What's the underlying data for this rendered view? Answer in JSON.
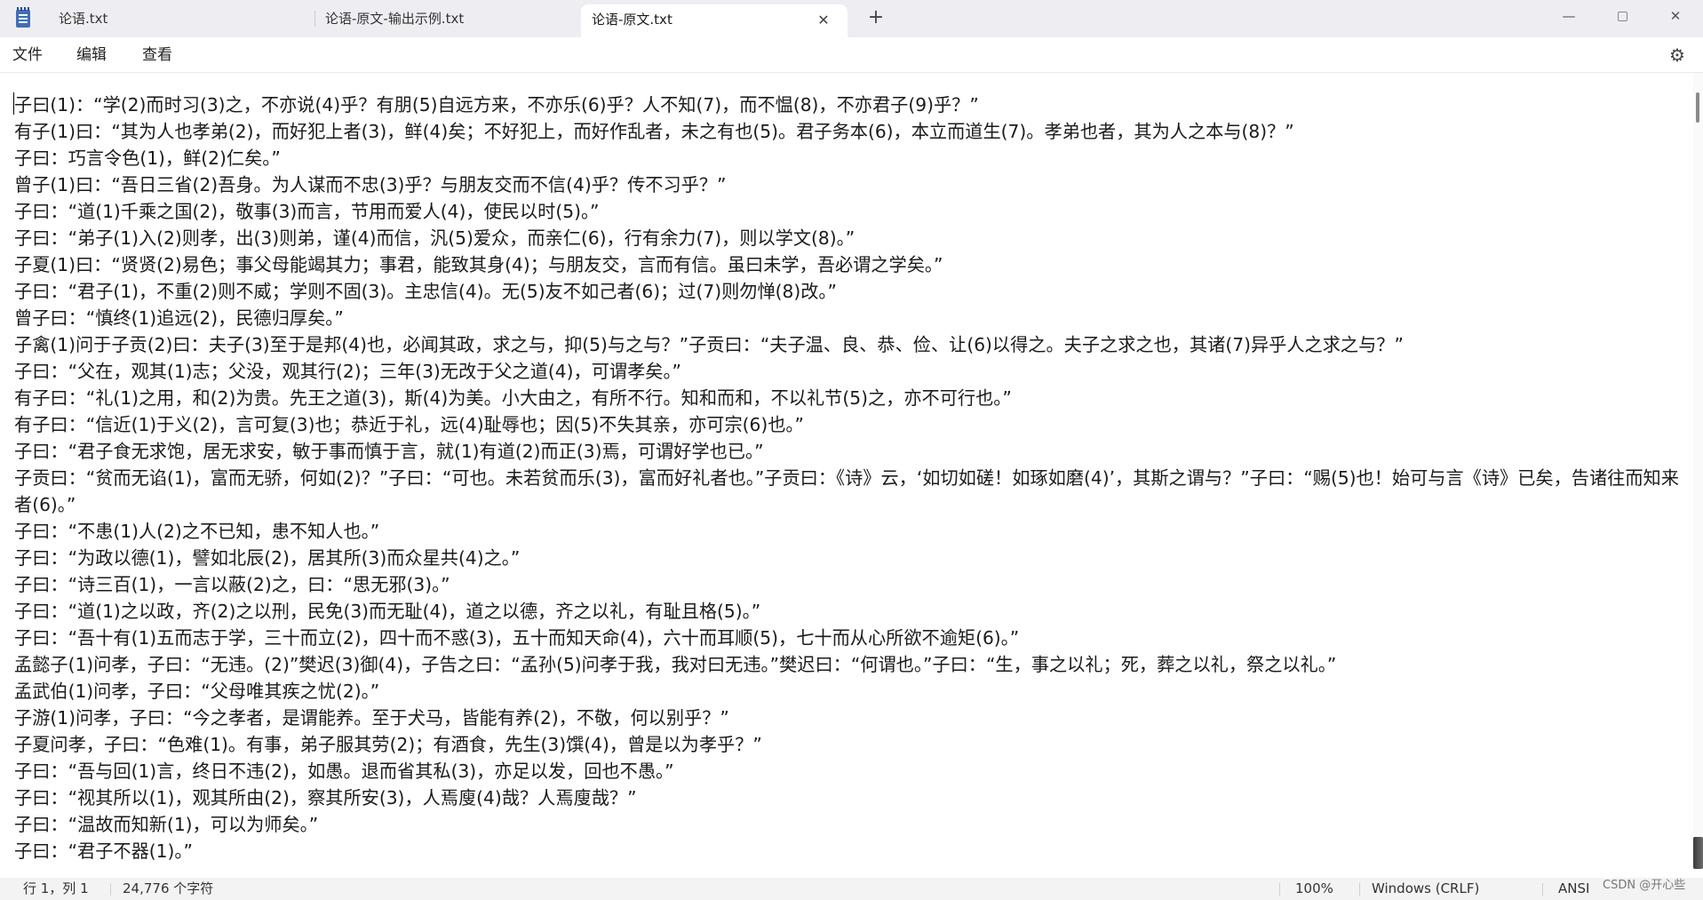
{
  "tabs": [
    {
      "label": "论语.txt"
    },
    {
      "label": "论语-原文-输出示例.txt"
    },
    {
      "label": "论语-原文.txt",
      "active": true
    }
  ],
  "icons": {
    "app": "notepad-icon",
    "close": "close-icon",
    "new_tab": "plus-icon",
    "settings": "gear-icon"
  },
  "menu": {
    "file": "文件",
    "edit": "编辑",
    "view": "查看"
  },
  "editor_text": "子曰(1)：“学(2)而时习(3)之，不亦说(4)乎？有朋(5)自远方来，不亦乐(6)乎？人不知(7)，而不愠(8)，不亦君子(9)乎？”\n有子(1)曰：“其为人也孝弟(2)，而好犯上者(3)，鲜(4)矣；不好犯上，而好作乱者，未之有也(5)。君子务本(6)，本立而道生(7)。孝弟也者，其为人之本与(8)？”\n子曰：巧言令色(1)，鲜(2)仁矣。”\n曾子(1)曰：“吾日三省(2)吾身。为人谋而不忠(3)乎？与朋友交而不信(4)乎？传不习乎？”\n子曰：“道(1)千乘之国(2)，敬事(3)而言，节用而爱人(4)，使民以时(5)。”\n子曰：“弟子(1)入(2)则孝，出(3)则弟，谨(4)而信，汎(5)爱众，而亲仁(6)，行有余力(7)，则以学文(8)。”\n子夏(1)曰：“贤贤(2)易色；事父母能竭其力；事君，能致其身(4)；与朋友交，言而有信。虽曰未学，吾必谓之学矣。”\n子曰：“君子(1)，不重(2)则不威；学则不固(3)。主忠信(4)。无(5)友不如己者(6)；过(7)则勿惮(8)改。”\n曾子曰：“慎终(1)追远(2)，民德归厚矣。”\n子禽(1)问于子贡(2)曰：夫子(3)至于是邦(4)也，必闻其政，求之与，抑(5)与之与？”子贡曰：“夫子温、良、恭、俭、让(6)以得之。夫子之求之也，其诸(7)异乎人之求之与？”\n子曰：“父在，观其(1)志；父没，观其行(2)；三年(3)无改于父之道(4)，可谓孝矣。”\n有子曰：“礼(1)之用，和(2)为贵。先王之道(3)，斯(4)为美。小大由之，有所不行。知和而和，不以礼节(5)之，亦不可行也。”\n有子曰：“信近(1)于义(2)，言可复(3)也；恭近于礼，远(4)耻辱也；因(5)不失其亲，亦可宗(6)也。”\n子曰：“君子食无求饱，居无求安，敏于事而慎于言，就(1)有道(2)而正(3)焉，可谓好学也已。”\n子贡曰：“贫而无谄(1)，富而无骄，何如(2)？”子曰：“可也。未若贫而乐(3)，富而好礼者也。”子贡曰：《诗》云，‘如切如磋！如琢如磨(4)’，其斯之谓与？”子曰：“赐(5)也！始可与言《诗》已矣，告诸往而知来者(6)。”\n子曰：“不患(1)人(2)之不已知，患不知人也。”\n子曰：“为政以德(1)，譬如北辰(2)，居其所(3)而众星共(4)之。”\n子曰：“诗三百(1)，一言以蔽(2)之，曰：“思无邪(3)。”\n子曰：“道(1)之以政，齐(2)之以刑，民免(3)而无耻(4)，道之以德，齐之以礼，有耻且格(5)。”\n子曰：“吾十有(1)五而志于学，三十而立(2)，四十而不惑(3)，五十而知天命(4)，六十而耳顺(5)，七十而从心所欲不逾矩(6)。”\n孟懿子(1)问孝，子曰：“无违。(2)”樊迟(3)御(4)，子告之曰：“孟孙(5)问孝于我，我对曰无违。”樊迟曰：“何谓也。”子曰：“生，事之以礼；死，葬之以礼，祭之以礼。”\n孟武伯(1)问孝，子曰：“父母唯其疾之忧(2)。”\n子游(1)问孝，子曰：“今之孝者，是谓能养。至于犬马，皆能有养(2)，不敬，何以别乎？”\n子夏问孝，子曰：“色难(1)。有事，弟子服其劳(2)；有酒食，先生(3)馔(4)，曾是以为孝乎？”\n子曰：“吾与回(1)言，终日不违(2)，如愚。退而省其私(3)，亦足以发，回也不愚。”\n子曰：“视其所以(1)，观其所由(2)，察其所安(3)，人焉廋(4)哉？人焉廋哉？”\n子曰：“温故而知新(1)，可以为师矣。”\n子曰：“君子不器(1)。”",
  "status": {
    "position": "行 1，列 1",
    "char_count": "24,776 个字符",
    "zoom": "100%",
    "line_ending": "Windows (CRLF)",
    "encoding": "ANSI"
  },
  "watermark": "CSDN @开心些"
}
